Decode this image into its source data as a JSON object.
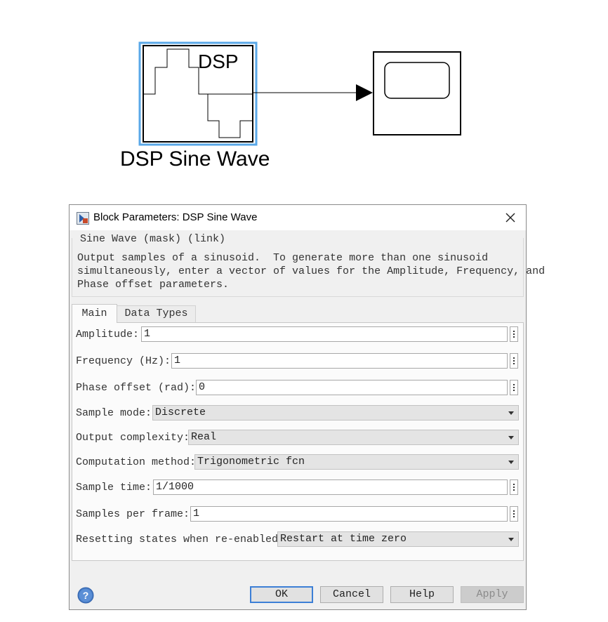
{
  "canvas": {
    "source_block": {
      "icon_text": "DSP",
      "caption": "DSP Sine Wave"
    }
  },
  "dialog": {
    "title": "Block Parameters: DSP Sine Wave",
    "group_title": "Sine Wave (mask) (link)",
    "description": "Output samples of a sinusoid.  To generate more than one sinusoid\nsimultaneously, enter a vector of values for the Amplitude, Frequency, and\nPhase offset parameters.",
    "tabs": [
      {
        "label": "Main"
      },
      {
        "label": "Data Types"
      }
    ],
    "params": {
      "amplitude": {
        "label": "Amplitude:",
        "value": "1"
      },
      "frequency": {
        "label": "Frequency (Hz):",
        "value": "1"
      },
      "phase_offset": {
        "label": "Phase offset (rad):",
        "value": "0"
      },
      "sample_mode": {
        "label": "Sample mode:",
        "value": "Discrete"
      },
      "output_complexity": {
        "label": "Output complexity:",
        "value": "Real"
      },
      "computation_method": {
        "label": "Computation method:",
        "value": "Trigonometric fcn"
      },
      "sample_time": {
        "label": "Sample time:",
        "value": "1/1000"
      },
      "samples_per_frame": {
        "label": "Samples per frame:",
        "value": "1"
      },
      "resetting_states": {
        "label": "Resetting states when re-enabled:",
        "value": "Restart at time zero"
      }
    },
    "buttons": {
      "ok": "OK",
      "cancel": "Cancel",
      "help": "Help",
      "apply": "Apply"
    }
  },
  "colors": {
    "selection": "#5aa8e8",
    "ok_border": "#3c7fd6",
    "help_icon": "#4a7fc8"
  },
  "icons": [
    "block-params-app-icon",
    "close-icon",
    "help-icon",
    "more-options-icon",
    "chevron-down-icon"
  ]
}
